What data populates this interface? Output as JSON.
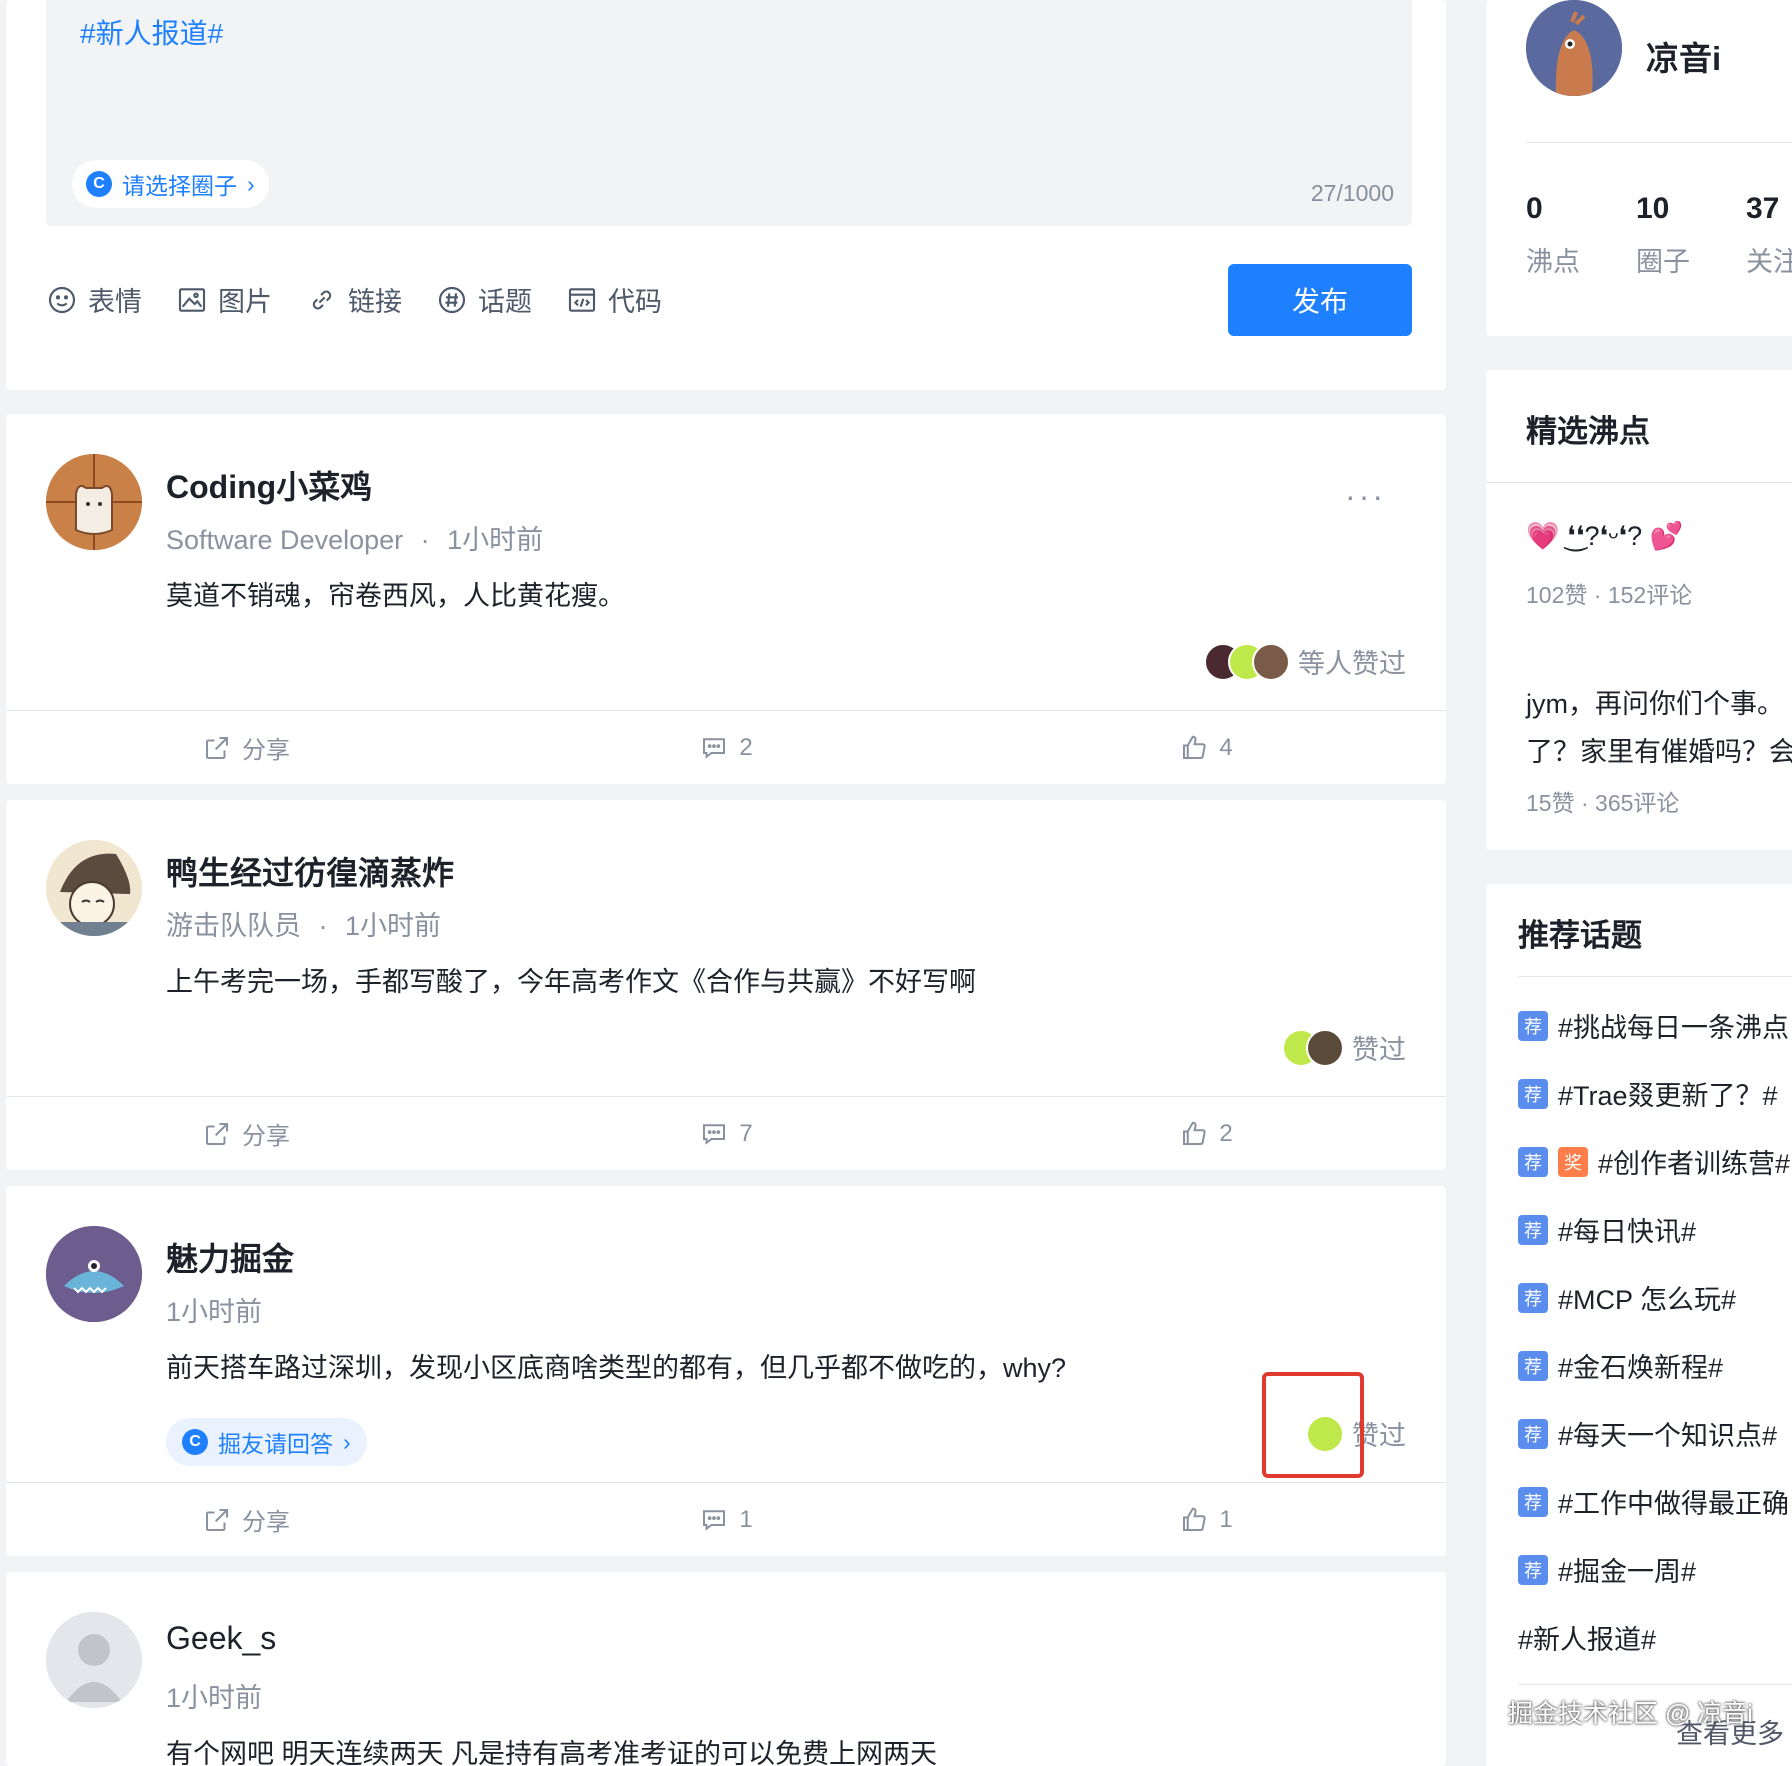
{
  "editor": {
    "topic_tag": "#新人报道#",
    "circle_placeholder": "请选择圈子",
    "char_count": "27/1000",
    "tools": [
      {
        "label": "表情",
        "icon": "smile-icon"
      },
      {
        "label": "图片",
        "icon": "image-icon"
      },
      {
        "label": "链接",
        "icon": "link-icon"
      },
      {
        "label": "话题",
        "icon": "hashtag-icon"
      },
      {
        "label": "代码",
        "icon": "code-icon"
      }
    ],
    "publish_label": "发布"
  },
  "posts": [
    {
      "username": "Coding小菜鸡",
      "title": "Software Developer",
      "sep": "·",
      "time": "1小时前",
      "content": "莫道不销魂，帘卷西风，人比黄花瘦。",
      "liked_text": "等人赞过",
      "share": "分享",
      "comments": "2",
      "likes": "4"
    },
    {
      "username": "鸭生经过彷徨滴蒸炸",
      "title": "游击队队员",
      "sep": "·",
      "time": "1小时前",
      "content": "上午考完一场，手都写酸了，今年高考作文《合作与共赢》不好写啊",
      "liked_text": "赞过",
      "share": "分享",
      "comments": "7",
      "likes": "2"
    },
    {
      "username": "魅力掘金",
      "time": "1小时前",
      "content": "前天搭车路过深圳，发现小区底商啥类型的都有，但几乎都不做吃的，why?",
      "circle": "掘友请回答",
      "liked_text": "赞过",
      "share": "分享",
      "comments": "1",
      "likes": "1"
    },
    {
      "username": "Geek_s",
      "time": "1小时前",
      "content": "有个网吧 明天连续两天 凡是持有高考准考证的可以免费上网两天"
    }
  ],
  "profile": {
    "name": "凉音i",
    "stats": [
      {
        "num": "0",
        "label": "沸点"
      },
      {
        "num": "10",
        "label": "圈子"
      },
      {
        "num": "37",
        "label": "关注"
      }
    ]
  },
  "featured": {
    "title": "精选沸点",
    "items": [
      {
        "text": "💗 ❛͜❛?❛ᵕ❛? 💕",
        "meta": "102赞 · 152评论"
      },
      {
        "text": "jym，再问你们个事。",
        "text2": "了？家里有催婚吗？会",
        "meta": "15赞 · 365评论"
      }
    ]
  },
  "topics": {
    "title": "推荐话题",
    "badge_rec": "荐",
    "badge_prize": "奖",
    "items": [
      {
        "label": "#挑战每日一条沸点",
        "rec": true
      },
      {
        "label": "#Trae叕更新了？#",
        "rec": true
      },
      {
        "label": "#创作者训练营#",
        "rec": true,
        "prize": true
      },
      {
        "label": "#每日快讯#",
        "rec": true
      },
      {
        "label": "#MCP 怎么玩#",
        "rec": true
      },
      {
        "label": "#金石焕新程#",
        "rec": true
      },
      {
        "label": "#每天一个知识点#",
        "rec": true
      },
      {
        "label": "#工作中做得最正确",
        "rec": true
      },
      {
        "label": "#掘金一周#",
        "rec": true
      },
      {
        "label": "#新人报道#",
        "rec": false
      }
    ],
    "more": "查看更多"
  },
  "watermark": "掘金技术社区 @ 凉音i",
  "colors": {
    "brand": "#1e80ff",
    "highlight": "#e03a2f",
    "text": "#1d2129",
    "muted": "#8a919f"
  }
}
